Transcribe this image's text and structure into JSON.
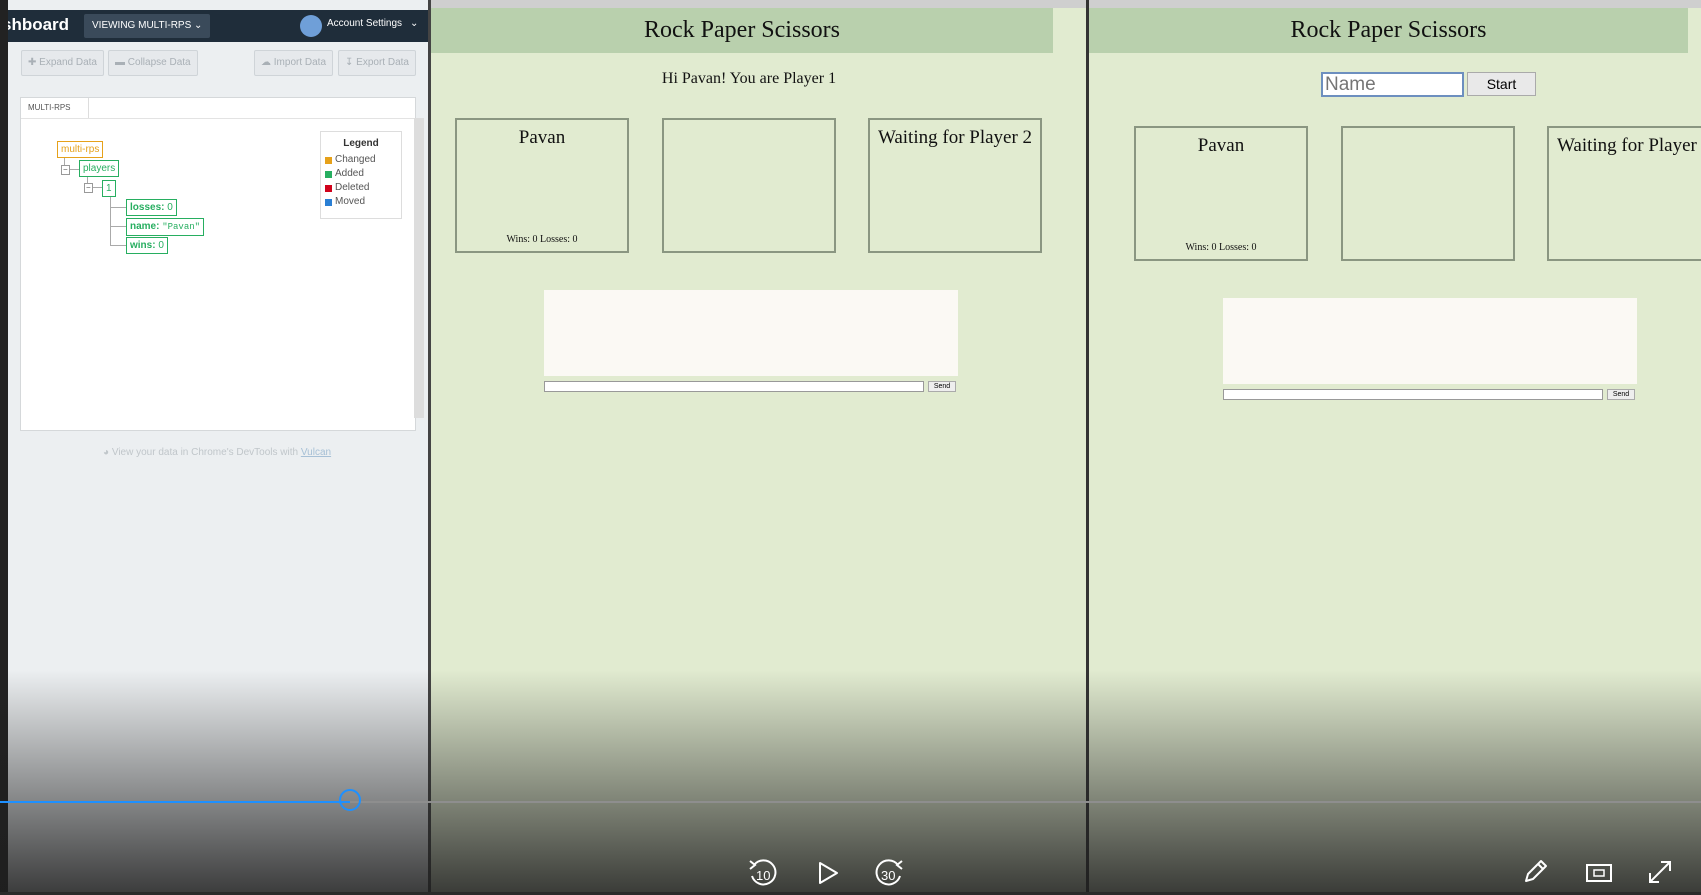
{
  "firebase": {
    "title": "shboard",
    "viewing": "VIEWING MULTI-RPS",
    "account": "Account Settings",
    "buttons": {
      "expand": "Expand Data",
      "collapse": "Collapse Data",
      "import": "Import Data",
      "export": "Export Data"
    },
    "breadcrumb": "MULTI-RPS",
    "tree": {
      "root": "multi-rps",
      "players": "players",
      "player_key": "1",
      "losses": "losses:",
      "losses_val": "0",
      "name": "name:",
      "name_val": "\"Pavan\"",
      "wins": "wins:",
      "wins_val": "0"
    },
    "legend": {
      "title": "Legend",
      "items": [
        {
          "label": "Changed",
          "color": "#e6a11a"
        },
        {
          "label": "Added",
          "color": "#27ae60"
        },
        {
          "label": "Deleted",
          "color": "#d0021b"
        },
        {
          "label": "Moved",
          "color": "#2a7fd4"
        }
      ]
    },
    "vulcan_text": "View your data in Chrome's DevTools with",
    "vulcan_link": "Vulcan"
  },
  "game1": {
    "title": "Rock Paper Scissors",
    "greeting": "Hi Pavan! You are Player 1",
    "player1": {
      "name": "Pavan",
      "stats": "Wins: 0 Losses: 0"
    },
    "player2": {
      "name": "Waiting for Player 2"
    },
    "send": "Send"
  },
  "game2": {
    "title": "Rock Paper Scissors",
    "name_placeholder": "Name",
    "start": "Start",
    "player1": {
      "name": "Pavan",
      "stats": "Wins: 0 Losses: 0"
    },
    "player2": {
      "name": "Waiting for Player"
    },
    "send": "Send"
  },
  "video": {
    "rewind": "10",
    "forward": "30",
    "progress": 0.206
  }
}
